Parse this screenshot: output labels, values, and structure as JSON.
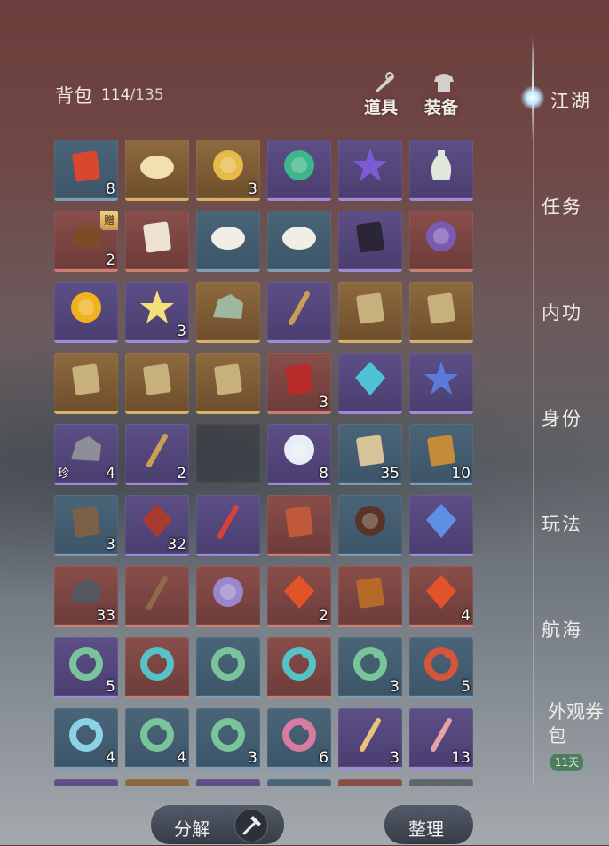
{
  "header": {
    "title": "背包",
    "count": "114",
    "max": "/135"
  },
  "header_tabs": [
    {
      "label": "道具"
    },
    {
      "label": "装备"
    }
  ],
  "items": [
    [
      {
        "q": "blue",
        "icon": "fu-talisman-icon",
        "qty": "8"
      },
      {
        "q": "gold",
        "icon": "scholar-portrait-icon",
        "qty": ""
      },
      {
        "q": "gold",
        "icon": "gold-coin-bird-icon",
        "qty": "3"
      },
      {
        "q": "purple",
        "icon": "green-gem-icon",
        "qty": ""
      },
      {
        "q": "purple",
        "icon": "purple-flower-icon",
        "qty": ""
      },
      {
        "q": "purple",
        "icon": "porcelain-vase-icon",
        "qty": ""
      }
    ],
    [
      {
        "q": "red",
        "icon": "ore-icon",
        "qty": "2",
        "badge": "赠"
      },
      {
        "q": "red",
        "icon": "scroll-icon",
        "qty": ""
      },
      {
        "q": "blue",
        "icon": "dumpling-plate-icon",
        "qty": ""
      },
      {
        "q": "blue",
        "icon": "dumpling-plate-icon",
        "qty": ""
      },
      {
        "q": "purple",
        "icon": "book-icon",
        "qty": ""
      },
      {
        "q": "red",
        "icon": "bowl-icon",
        "qty": ""
      }
    ],
    [
      {
        "q": "purple",
        "icon": "golden-rose-icon",
        "qty": ""
      },
      {
        "q": "purple",
        "icon": "golden-flame-icon",
        "qty": "3"
      },
      {
        "q": "gold",
        "icon": "jade-stone-icon",
        "qty": ""
      },
      {
        "q": "purple",
        "icon": "brush-icon",
        "qty": ""
      },
      {
        "q": "gold",
        "icon": "manuscript-icon",
        "qty": ""
      },
      {
        "q": "gold",
        "icon": "manuscript-icon",
        "qty": ""
      }
    ],
    [
      {
        "q": "gold",
        "icon": "manuscript-icon",
        "qty": ""
      },
      {
        "q": "gold",
        "icon": "manuscript-icon",
        "qty": ""
      },
      {
        "q": "gold",
        "icon": "manuscript-icon",
        "qty": ""
      },
      {
        "q": "red",
        "icon": "red-envelope-icon",
        "qty": "3"
      },
      {
        "q": "purple",
        "icon": "blue-crystal-icon",
        "qty": ""
      },
      {
        "q": "purple",
        "icon": "blue-flower-branch-icon",
        "qty": ""
      }
    ],
    [
      {
        "q": "purple",
        "icon": "rock-icon",
        "qty": "4",
        "tag": "珍"
      },
      {
        "q": "purple",
        "icon": "brush-icon",
        "qty": "2"
      },
      {
        "q": "empty"
      },
      {
        "q": "purple",
        "icon": "pearl-icon",
        "qty": "8"
      },
      {
        "q": "blue",
        "icon": "token-icon",
        "qty": "35"
      },
      {
        "q": "blue",
        "icon": "ticket-icon",
        "qty": "10"
      }
    ],
    [
      {
        "q": "blue",
        "icon": "tools-icon",
        "qty": "3"
      },
      {
        "q": "purple",
        "icon": "medal-icon",
        "qty": "32"
      },
      {
        "q": "purple",
        "icon": "ribbon-icon",
        "qty": ""
      },
      {
        "q": "red",
        "icon": "paper-note-icon",
        "qty": ""
      },
      {
        "q": "blue",
        "icon": "chocolate-icon",
        "qty": ""
      },
      {
        "q": "purple",
        "icon": "gem-pile-icon",
        "qty": ""
      }
    ],
    [
      {
        "q": "red",
        "icon": "iron-ore-icon",
        "qty": "33"
      },
      {
        "q": "red",
        "icon": "staff-icon",
        "qty": ""
      },
      {
        "q": "red",
        "icon": "amulet-icon",
        "qty": ""
      },
      {
        "q": "red",
        "icon": "fire-crystal-icon",
        "qty": "2"
      },
      {
        "q": "red",
        "icon": "hammer-icon",
        "qty": ""
      },
      {
        "q": "red",
        "icon": "fire-crystal-icon",
        "qty": "4"
      }
    ],
    [
      {
        "q": "purple",
        "icon": "green-jade-icon",
        "qty": "5"
      },
      {
        "q": "red",
        "icon": "teal-jade-icon",
        "qty": ""
      },
      {
        "q": "blue",
        "icon": "green-jade-icon",
        "qty": ""
      },
      {
        "q": "red",
        "icon": "teal-jade-icon",
        "qty": ""
      },
      {
        "q": "blue",
        "icon": "green-jade-icon",
        "qty": "3"
      },
      {
        "q": "blue",
        "icon": "red-jade-icon",
        "qty": "5"
      }
    ],
    [
      {
        "q": "blue",
        "icon": "blue-jade-icon",
        "qty": "4"
      },
      {
        "q": "blue",
        "icon": "green-jade-icon",
        "qty": "4"
      },
      {
        "q": "blue",
        "icon": "green-jade-icon",
        "qty": "3"
      },
      {
        "q": "blue",
        "icon": "pink-jade-icon",
        "qty": "6"
      },
      {
        "q": "purple",
        "icon": "charm-tag-icon",
        "qty": "3"
      },
      {
        "q": "purple",
        "icon": "pink-tag-icon",
        "qty": "13"
      }
    ],
    [
      {
        "q": "purple",
        "icon": "",
        "qty": ""
      },
      {
        "q": "gold",
        "icon": "",
        "qty": ""
      },
      {
        "q": "purple",
        "icon": "",
        "qty": ""
      },
      {
        "q": "blue",
        "icon": "",
        "qty": ""
      },
      {
        "q": "red",
        "icon": "",
        "qty": ""
      },
      {
        "q": "empty"
      }
    ]
  ],
  "sidebar": [
    {
      "label": "江湖",
      "active": true
    },
    {
      "label": "任务"
    },
    {
      "label": "内功"
    },
    {
      "label": "身份"
    },
    {
      "label": "玩法"
    },
    {
      "label": "航海"
    },
    {
      "label": "外观券包",
      "badge": "11天"
    }
  ],
  "buttons": {
    "decompose": "分解",
    "sort": "整理"
  },
  "colors": {
    "accent_glow": "#bfe6ff",
    "badge_green": "#4d7c5e"
  }
}
